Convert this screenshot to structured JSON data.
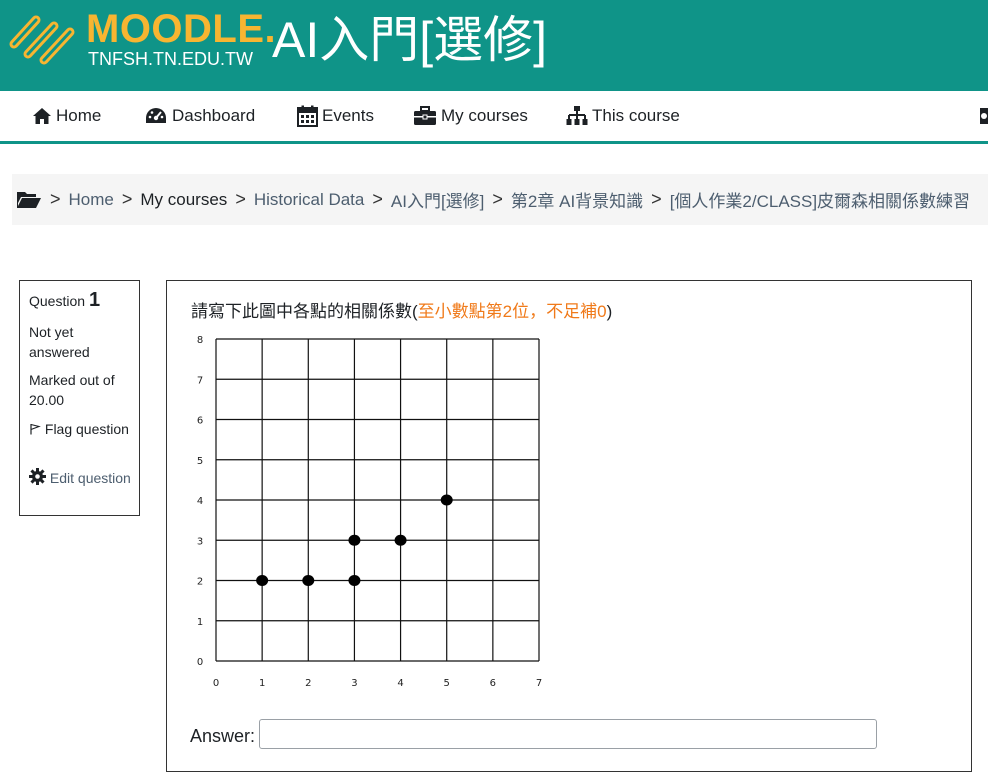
{
  "header": {
    "brand_name": "MOODLE.",
    "brand_sub": "TNFSH.TN.EDU.TW",
    "site_title": "AI入門[選修]",
    "logo_icon": "moodle-logo-icon",
    "background_color": "#0f9488",
    "brand_color": "#f7b531"
  },
  "nav": {
    "items": [
      {
        "label": "Home",
        "icon": "home-icon"
      },
      {
        "label": "Dashboard",
        "icon": "dashboard-icon"
      },
      {
        "label": "Events",
        "icon": "calendar-icon"
      },
      {
        "label": "My courses",
        "icon": "briefcase-icon"
      },
      {
        "label": "This course",
        "icon": "sitemap-icon"
      }
    ]
  },
  "breadcrumb": {
    "icon": "folder-open-icon",
    "separator": ">",
    "items": [
      {
        "label": "Home"
      },
      {
        "label": "My courses"
      },
      {
        "label": "Historical Data"
      },
      {
        "label": "AI入門[選修]"
      },
      {
        "label": "第2章 AI背景知識"
      },
      {
        "label": "[個人作業2/CLASS]皮爾森相關係數練習"
      }
    ]
  },
  "question_info": {
    "title_prefix": "Question",
    "number": "1",
    "state": "Not yet answered",
    "marked_out_of": "Marked out of 20.00",
    "flag_label": "Flag question",
    "edit_label": "Edit question"
  },
  "question": {
    "text_main": "請寫下此圖中各點的相關係數(",
    "text_highlight": "至小數點第2位，不足補0",
    "text_end": ")",
    "highlight_color": "#f07a1a",
    "answer_label": "Answer:",
    "answer_value": ""
  },
  "chart_data": {
    "type": "scatter",
    "title": "",
    "xlabel": "",
    "ylabel": "",
    "xlim": [
      0,
      7
    ],
    "ylim": [
      0,
      8
    ],
    "x_ticks": [
      "0",
      "1",
      "2",
      "3",
      "4",
      "5",
      "6",
      "7"
    ],
    "y_ticks": [
      "0",
      "1",
      "2",
      "3",
      "4",
      "5",
      "6",
      "7",
      "8"
    ],
    "grid": true,
    "points": [
      {
        "x": 1,
        "y": 2
      },
      {
        "x": 2,
        "y": 2
      },
      {
        "x": 3,
        "y": 2
      },
      {
        "x": 3,
        "y": 3
      },
      {
        "x": 4,
        "y": 3
      },
      {
        "x": 5,
        "y": 4
      }
    ]
  }
}
